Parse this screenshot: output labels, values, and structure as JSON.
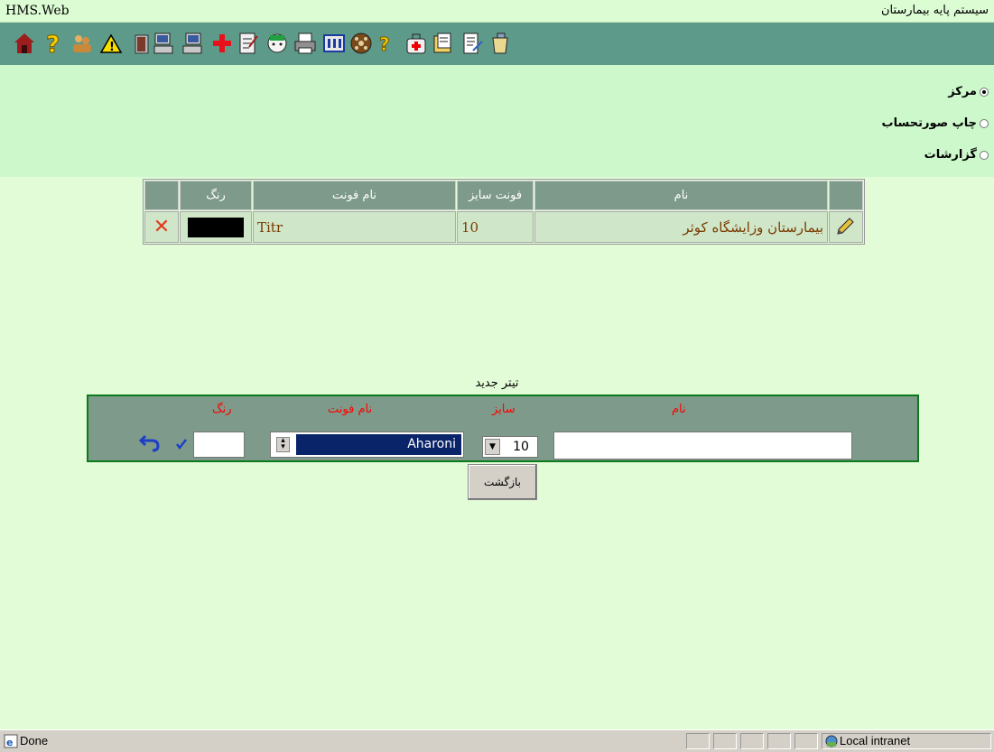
{
  "titlebar": {
    "app_title": "HMS.Web",
    "system_title": "سیستم پایه بیمارستان"
  },
  "toolbar": {
    "icons": [
      "house-icon",
      "help-icon",
      "users-icon",
      "warning-icon",
      "door-exit-icon",
      "computer-left-icon",
      "computer-right-icon",
      "red-cross-icon",
      "form-edit-icon",
      "nurse-icon",
      "printer-icon",
      "grid-icon",
      "film-reel-icon",
      "help-2-icon",
      "medical-bag-icon",
      "folder-docs-icon",
      "document-edit-icon",
      "cup-icon"
    ]
  },
  "menu": {
    "options": [
      {
        "label": "مرکز",
        "selected": true
      },
      {
        "label": "چاپ صورتحساب",
        "selected": false
      },
      {
        "label": "گزارشات",
        "selected": false
      }
    ]
  },
  "table": {
    "headers": {
      "name": "نام",
      "font_size": "فونت سایز",
      "font_name": "نام فونت",
      "color": "رنگ"
    },
    "rows": [
      {
        "name": "بیمارستان وزایشگاه کوثر",
        "font_size": "10",
        "font_name": "Titr",
        "color": "#000000"
      }
    ]
  },
  "new_title": {
    "heading": "تیتر جدید",
    "labels": {
      "name": "نام",
      "size": "سایز",
      "font_name": "نام فونت",
      "color": "رنگ"
    },
    "name_value": "",
    "size_value": "10",
    "font_value": "Aharoni",
    "color_value": ""
  },
  "back_button": "بازگشت",
  "statusbar": {
    "status": "Done",
    "zone": "Local intranet"
  },
  "colors": {
    "toolbar_bg": "#5e9a8a",
    "page_bg": "#e2fcd8",
    "menu_bg": "#ccf8cc",
    "header_bg": "#7d9a8a",
    "label_red": "#ff0000",
    "box_border": "#0b7a1c"
  }
}
